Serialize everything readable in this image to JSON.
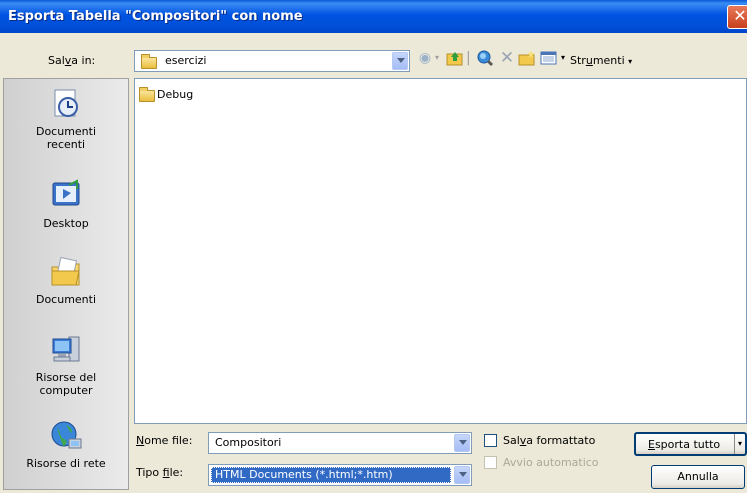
{
  "dialog": {
    "title": "Esporta Tabella \"Compositori\" con nome"
  },
  "header": {
    "salva_in_pre": "Sal",
    "salva_in_u": "v",
    "salva_in_post": "a in:",
    "folder_name": "esercizi",
    "tools_pre": "Str",
    "tools_u": "u",
    "tools_post": "menti"
  },
  "places": [
    {
      "label_line1": "Documenti",
      "label_line2": "recenti",
      "icon": "recent-documents-icon"
    },
    {
      "label_line1": "Desktop",
      "label_line2": "",
      "icon": "desktop-icon"
    },
    {
      "label_line1": "Documenti",
      "label_line2": "",
      "icon": "my-documents-icon"
    },
    {
      "label_line1": "Risorse del",
      "label_line2": "computer",
      "icon": "my-computer-icon"
    },
    {
      "label_line1": "Risorse di rete",
      "label_line2": "",
      "icon": "network-places-icon"
    }
  ],
  "files": [
    {
      "name": "Debug",
      "type": "folder"
    }
  ],
  "form": {
    "filename_label_pre": "",
    "filename_label_u": "N",
    "filename_label_post": "ome file:",
    "filename_value": "Compositori",
    "filetype_label_pre": "Tipo ",
    "filetype_label_u": "f",
    "filetype_label_post": "ile:",
    "filetype_value": "HTML Documents (*.html;*.htm)",
    "save_formatted_pre": "Sal",
    "save_formatted_u": "v",
    "save_formatted_post": "a formattato",
    "autostart_label": "Avvio automatico",
    "export_button_u": "E",
    "export_button_post": "sporta tutto",
    "cancel_button": "Annulla"
  }
}
